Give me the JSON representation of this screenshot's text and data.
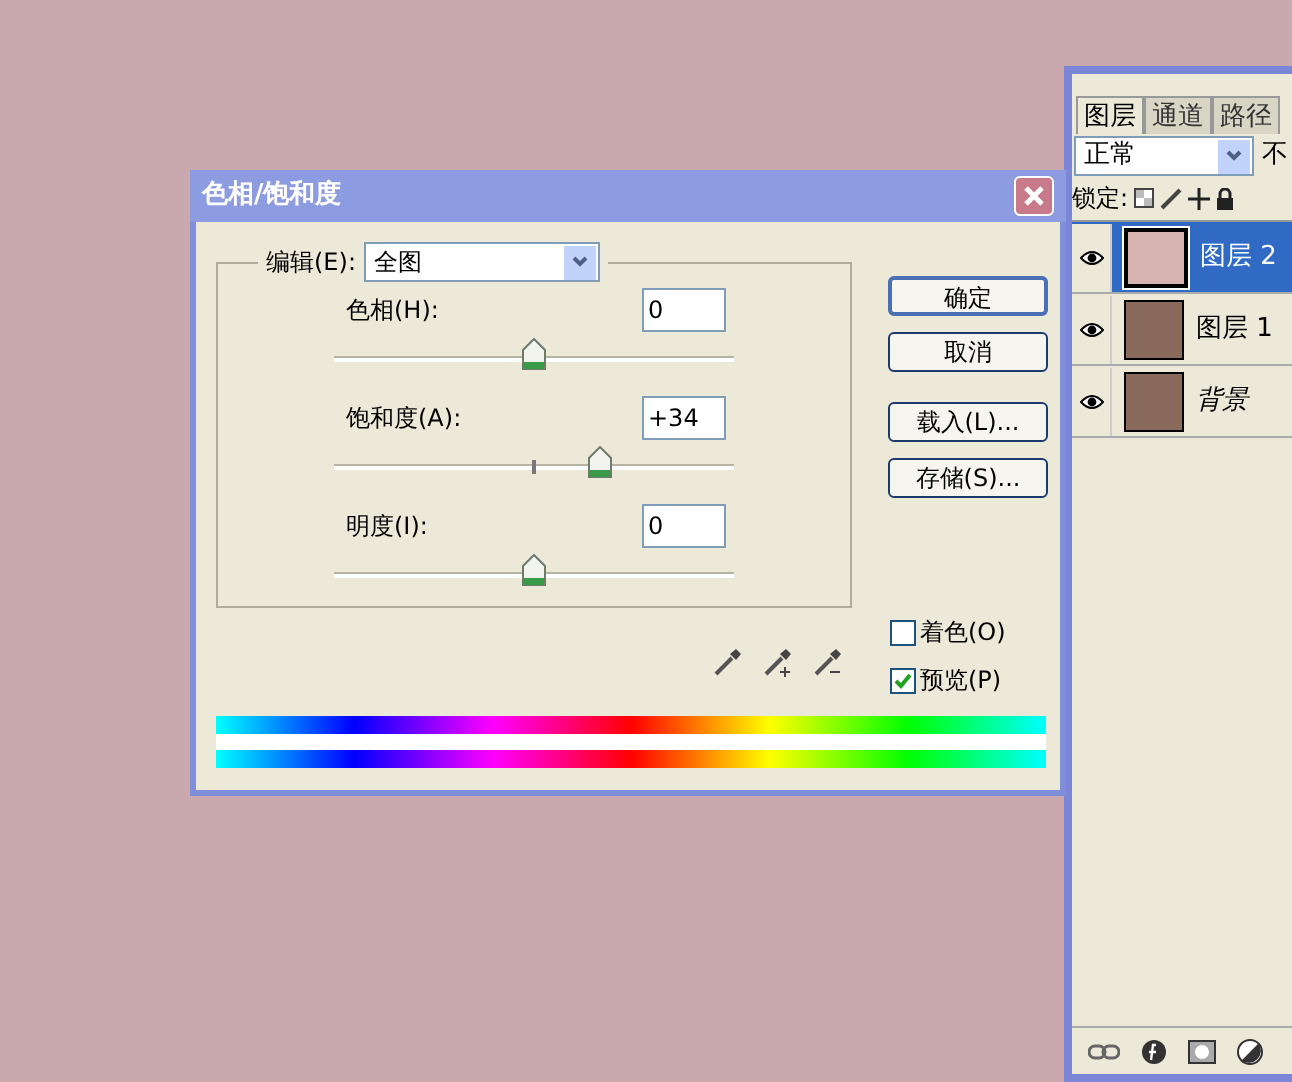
{
  "dialog": {
    "title": "色相/饱和度",
    "edit": {
      "label": "编辑(E):",
      "value": "全图"
    },
    "sliders": [
      {
        "label": "色相(H):",
        "value": "0",
        "level": 0.5
      },
      {
        "label": "饱和度(A):",
        "value": "+34",
        "level": 0.665
      },
      {
        "label": "明度(I):",
        "value": "0",
        "level": 0.5
      }
    ],
    "buttons": [
      {
        "label": "确定",
        "default": true
      },
      {
        "label": "取消",
        "default": false
      },
      {
        "label": "载入(L)...",
        "default": false
      },
      {
        "label": "存储(S)...",
        "default": false
      }
    ],
    "options": [
      {
        "label": "着色(O)",
        "checked": false
      },
      {
        "label": "预览(P)",
        "checked": true
      }
    ]
  },
  "layers_panel": {
    "tabs": [
      {
        "label": "图层",
        "selected": true
      },
      {
        "label": "通道",
        "selected": false
      },
      {
        "label": "路径",
        "selected": false
      }
    ],
    "blend_mode": "正常",
    "opacity_label": "不",
    "lock_label": "锁定:",
    "layers": [
      {
        "name": "图层 2",
        "kind": "fill",
        "selected": true,
        "visible": true
      },
      {
        "name": "图层 1",
        "kind": "photo",
        "selected": false,
        "visible": true
      },
      {
        "name": "背景",
        "kind": "background",
        "selected": false,
        "visible": true
      }
    ]
  }
}
